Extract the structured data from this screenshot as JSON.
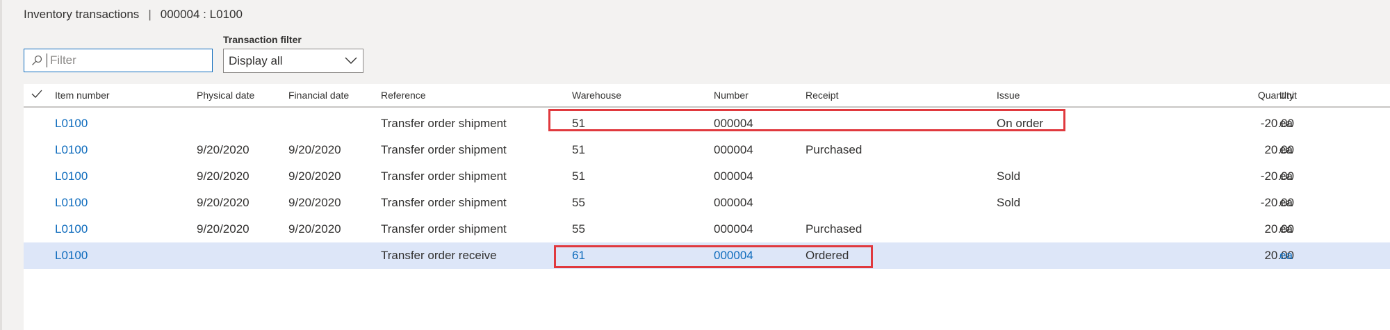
{
  "header": {
    "title": "Inventory transactions",
    "separator": "|",
    "record": "000004 : L0100"
  },
  "filter": {
    "placeholder": "Filter",
    "value": ""
  },
  "transaction_filter": {
    "label": "Transaction filter",
    "selected": "Display all"
  },
  "grid": {
    "columns": [
      "Item number",
      "Physical date",
      "Financial date",
      "Reference",
      "Warehouse",
      "Number",
      "Receipt",
      "Issue",
      "Quantity",
      "Unit"
    ],
    "rows": [
      {
        "item": "L0100",
        "physical_date": "",
        "financial_date": "",
        "reference": "Transfer order shipment",
        "warehouse": "51",
        "number": "000004",
        "receipt": "",
        "issue": "On order",
        "quantity": "-20.00",
        "unit": "ea",
        "selected": false
      },
      {
        "item": "L0100",
        "physical_date": "9/20/2020",
        "financial_date": "9/20/2020",
        "reference": "Transfer order shipment",
        "warehouse": "51",
        "number": "000004",
        "receipt": "Purchased",
        "issue": "",
        "quantity": "20.00",
        "unit": "ea",
        "selected": false
      },
      {
        "item": "L0100",
        "physical_date": "9/20/2020",
        "financial_date": "9/20/2020",
        "reference": "Transfer order shipment",
        "warehouse": "51",
        "number": "000004",
        "receipt": "",
        "issue": "Sold",
        "quantity": "-20.00",
        "unit": "ea",
        "selected": false
      },
      {
        "item": "L0100",
        "physical_date": "9/20/2020",
        "financial_date": "9/20/2020",
        "reference": "Transfer order shipment",
        "warehouse": "55",
        "number": "000004",
        "receipt": "",
        "issue": "Sold",
        "quantity": "-20.00",
        "unit": "ea",
        "selected": false
      },
      {
        "item": "L0100",
        "physical_date": "9/20/2020",
        "financial_date": "9/20/2020",
        "reference": "Transfer order shipment",
        "warehouse": "55",
        "number": "000004",
        "receipt": "Purchased",
        "issue": "",
        "quantity": "20.00",
        "unit": "ea",
        "selected": false
      },
      {
        "item": "L0100",
        "physical_date": "",
        "financial_date": "",
        "reference": "Transfer order receive",
        "warehouse": "61",
        "number": "000004",
        "receipt": "Ordered",
        "issue": "",
        "quantity": "20.00",
        "unit": "ea",
        "selected": true
      }
    ]
  },
  "colors": {
    "link": "#0f6cbd",
    "selected_row": "#dde6f8",
    "highlight": "#e0393e"
  }
}
